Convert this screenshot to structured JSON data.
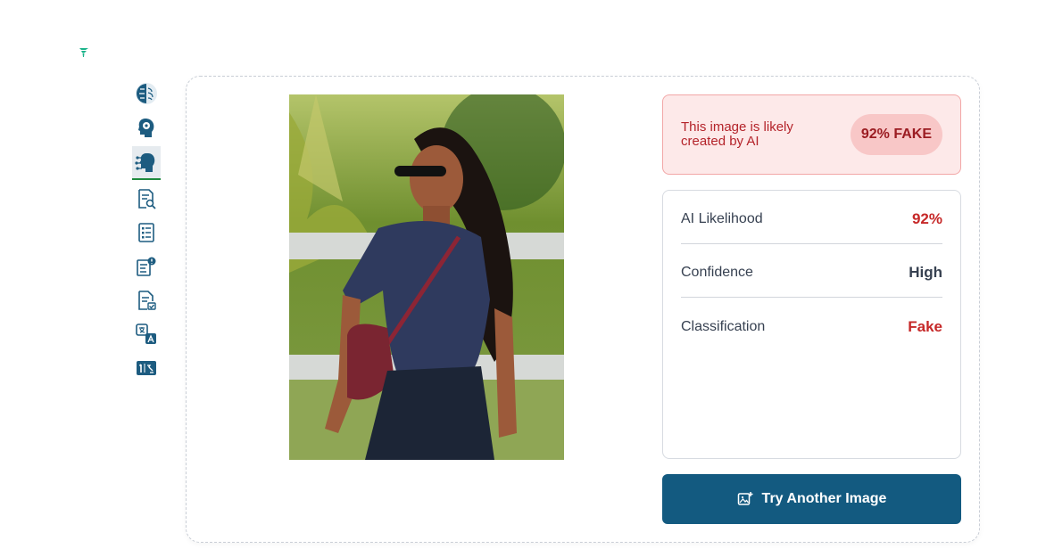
{
  "sidebar": {
    "items": [
      {
        "icon": "brain-icon"
      },
      {
        "icon": "head-gear-icon"
      },
      {
        "icon": "ai-head-icon",
        "active": true
      },
      {
        "icon": "document-search-icon"
      },
      {
        "icon": "checklist-document-icon"
      },
      {
        "icon": "document-alert-icon"
      },
      {
        "icon": "document-check-icon"
      },
      {
        "icon": "translate-icon"
      },
      {
        "icon": "number-fraction-icon"
      }
    ]
  },
  "verdict": {
    "message": "This image is likely created by AI",
    "badge": "92% FAKE"
  },
  "details": [
    {
      "label": "AI Likelihood",
      "value": "92%",
      "tone": "red"
    },
    {
      "label": "Confidence",
      "value": "High",
      "tone": "dark"
    },
    {
      "label": "Classification",
      "value": "Fake",
      "tone": "red"
    }
  ],
  "actions": {
    "try_another_label": "Try Another Image"
  },
  "colors": {
    "primary": "#135a80",
    "fake_red": "#c62828",
    "verdict_bg": "#fde9e9",
    "active_underline": "#1f8a3e"
  }
}
